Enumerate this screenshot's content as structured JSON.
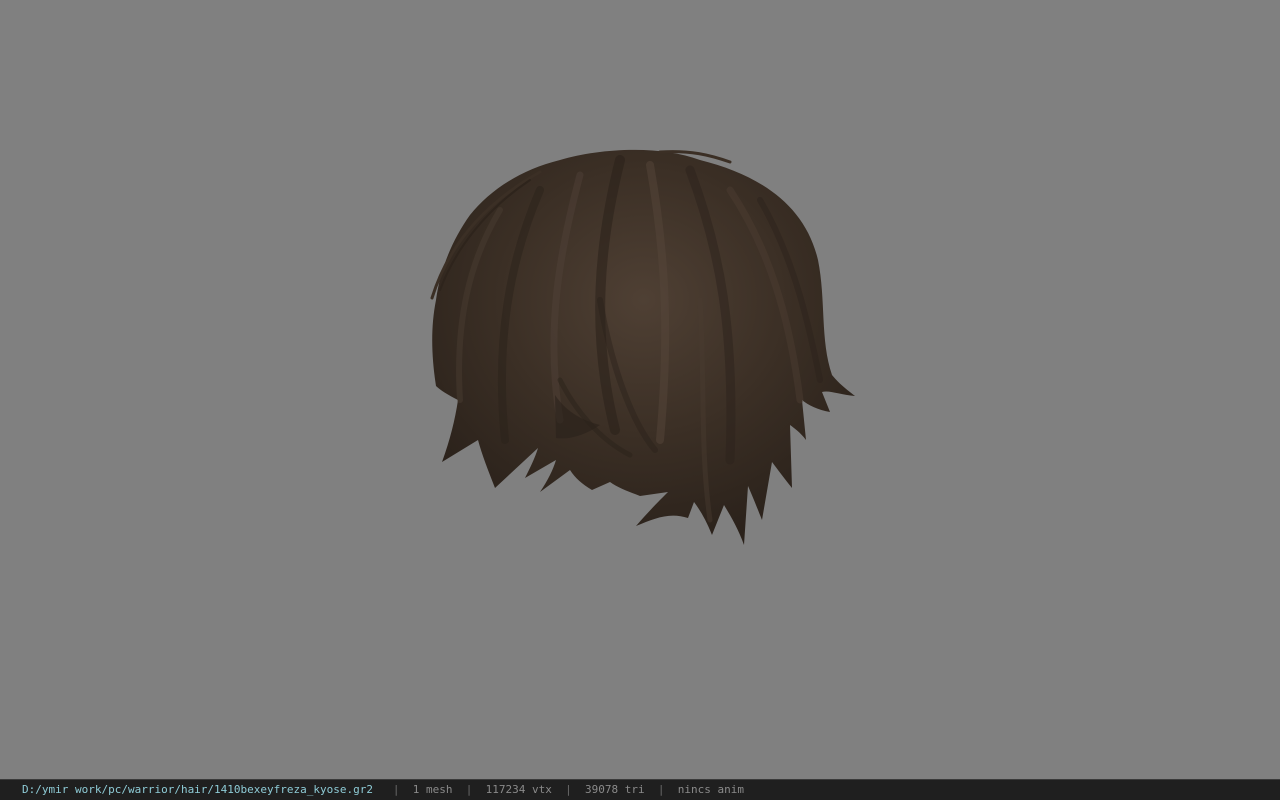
{
  "viewport": {
    "background_color": "#808080",
    "model": "hair-mesh",
    "hair_colors": {
      "dark": "#2a211a",
      "mid": "#3e3127",
      "light": "#56463a"
    }
  },
  "status_bar": {
    "file_path": "D:/ymir work/pc/warrior/hair/1410bexeyfreza_kyose.gr2",
    "separator": "|",
    "mesh_count": "1 mesh",
    "vertex_count": "117234 vtx",
    "triangle_count": "39078 tri",
    "anim_status": "nincs anim",
    "path_color": "#8ecbd6"
  }
}
